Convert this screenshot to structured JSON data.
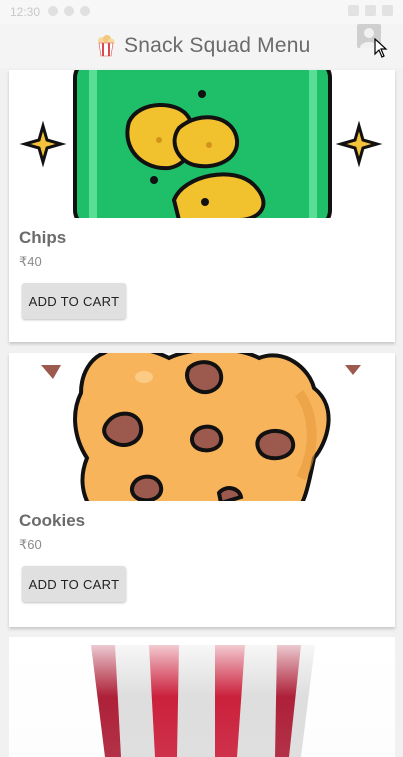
{
  "status_bar": {
    "time": "12:30"
  },
  "app_bar": {
    "title": "Snack Squad Menu",
    "icon": "popcorn-icon",
    "profile_icon": "profile-icon"
  },
  "products": [
    {
      "name": "Chips",
      "price": "₹40",
      "button_label": "ADD TO CART",
      "image": "chips-image"
    },
    {
      "name": "Cookies",
      "price": "₹60",
      "button_label": "ADD TO CART",
      "image": "cookie-image"
    },
    {
      "name": "",
      "price": "",
      "button_label": "",
      "image": "popcorn-bucket-image"
    }
  ],
  "colors": {
    "chips_green": "#1fbf6a",
    "chips_yellow": "#f2c12e",
    "cookie_orange": "#f8b45a",
    "chocolate": "#9c5a4f",
    "popcorn_red": "#c8102e"
  }
}
